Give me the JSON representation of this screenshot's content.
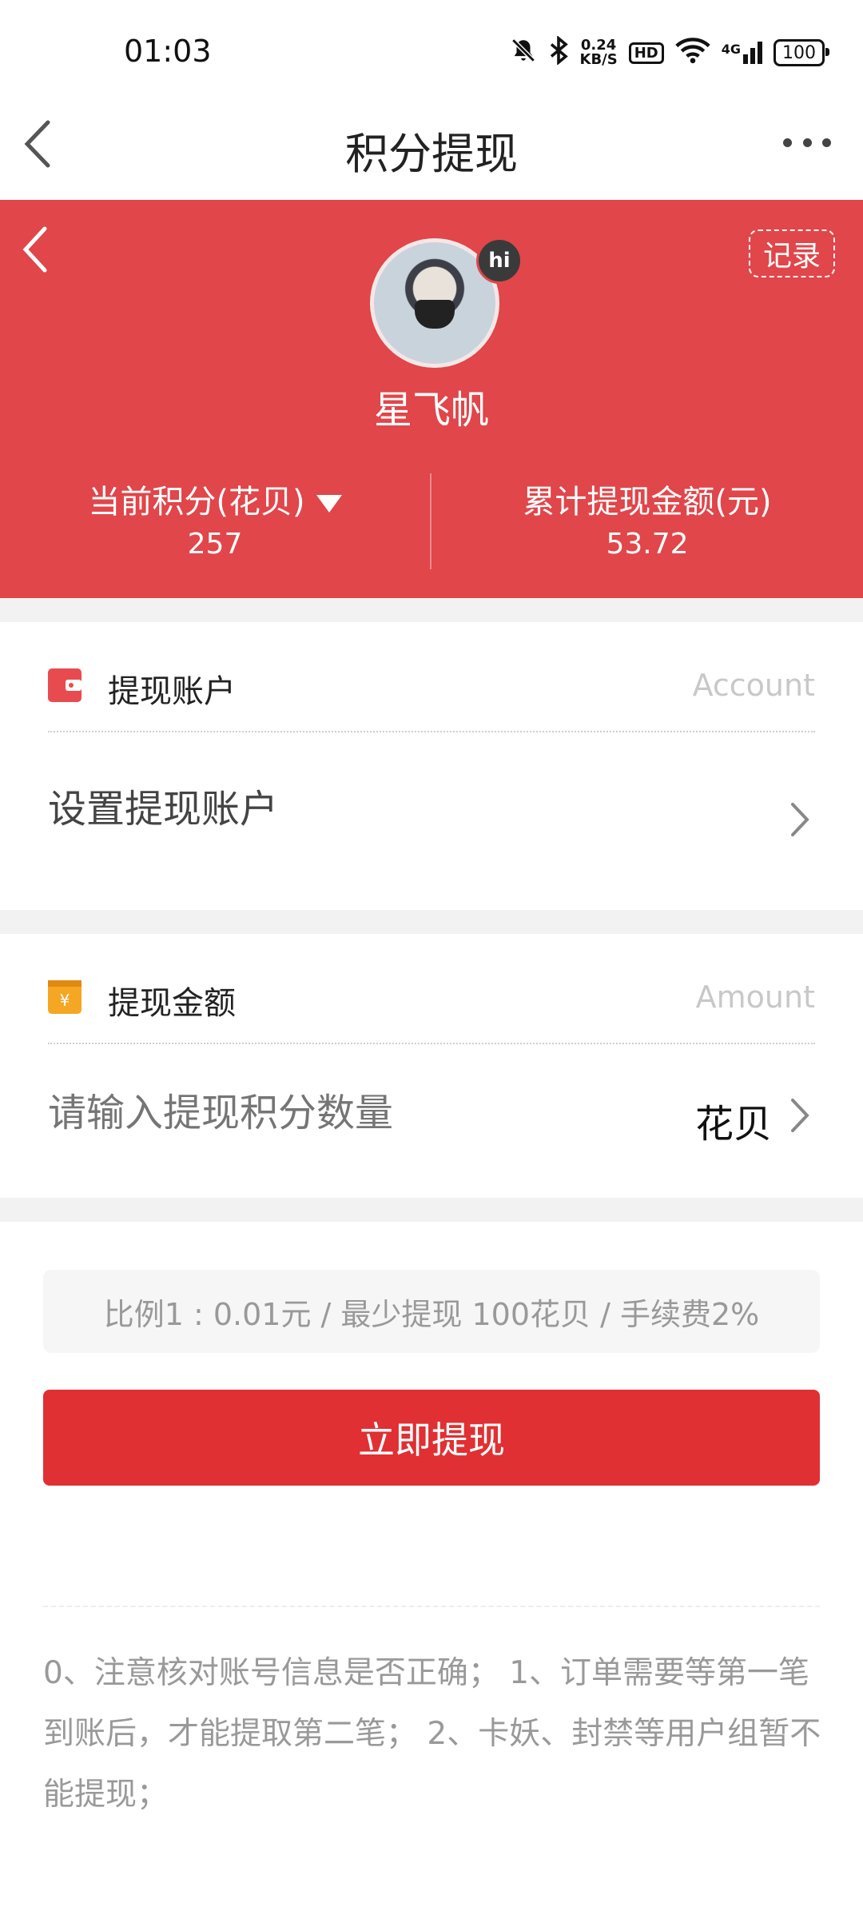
{
  "status_bar": {
    "time": "01:03",
    "network_speed_value": "0.24",
    "network_speed_unit": "KB/S",
    "hd_label": "HD",
    "signal_label": "4G",
    "battery": "100",
    "icons": [
      "mute-bell-icon",
      "bluetooth-icon",
      "wifi-icon",
      "signal-icon",
      "battery-icon"
    ]
  },
  "nav": {
    "title": "积分提现"
  },
  "profile": {
    "record_label": "记录",
    "hi_badge": "hi",
    "username": "星飞帆",
    "points_label": "当前积分(花贝)",
    "points_value": "257",
    "withdrawn_label": "累计提现金额(元)",
    "withdrawn_value": "53.72"
  },
  "account_section": {
    "title": "提现账户",
    "hint": "Account",
    "row_text": "设置提现账户"
  },
  "amount_section": {
    "title": "提现金额",
    "hint": "Amount",
    "placeholder": "请输入提现积分数量",
    "unit": "花贝"
  },
  "info": "比例1 : 0.01元 / 最少提现 100花贝 / 手续费2%",
  "submit_label": "立即提现",
  "notes": "0、注意核对账号信息是否正确； 1、订单需要等第一笔到账后，才能提取第二笔； 2、卡妖、封禁等用户组暂不能提现；",
  "colors": {
    "accent_red": "#e0464a",
    "button_red": "#e03033",
    "wallet_icon_red": "#e84b4f",
    "amount_icon_orange": "#f5a623"
  }
}
